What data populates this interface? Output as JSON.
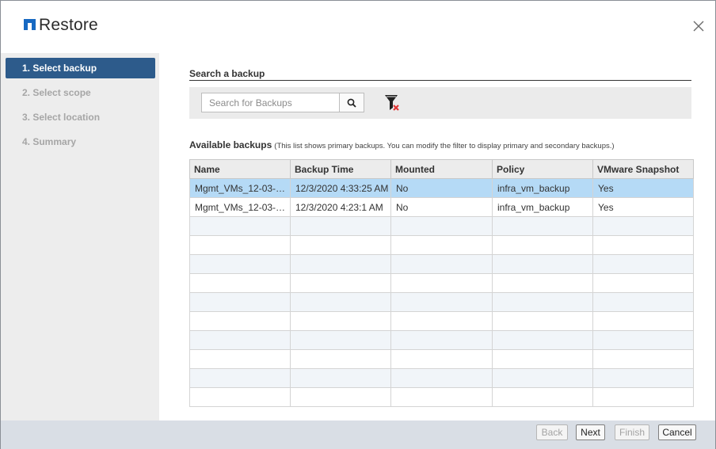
{
  "dialog": {
    "title": "Restore",
    "brand_color": "#1769c2"
  },
  "sidebar": {
    "steps": [
      {
        "label": "1. Select backup",
        "state": "active"
      },
      {
        "label": "2. Select scope",
        "state": "disabled"
      },
      {
        "label": "3. Select location",
        "state": "disabled"
      },
      {
        "label": "4. Summary",
        "state": "disabled"
      }
    ]
  },
  "search": {
    "title": "Search a backup",
    "placeholder": "Search for Backups",
    "value": "",
    "search_icon": "search-icon",
    "clear_filter_icon": "filter-clear-icon"
  },
  "backups": {
    "heading": "Available backups",
    "note": "(This list shows primary backups. You can modify the filter to display primary and secondary backups.)",
    "columns": [
      "Name",
      "Backup Time",
      "Mounted",
      "Policy",
      "VMware Snapshot"
    ],
    "rows": [
      {
        "name": "Mgmt_VMs_12-03-2…",
        "time": "12/3/2020 4:33:25 AM",
        "mounted": "No",
        "policy": "infra_vm_backup",
        "snapshot": "Yes",
        "selected": true
      },
      {
        "name": "Mgmt_VMs_12-03-2…",
        "time": "12/3/2020 4:23:1 AM",
        "mounted": "No",
        "policy": "infra_vm_backup",
        "snapshot": "Yes",
        "selected": false
      }
    ],
    "empty_rows": 10
  },
  "footer": {
    "back": "Back",
    "next": "Next",
    "finish": "Finish",
    "cancel": "Cancel"
  }
}
